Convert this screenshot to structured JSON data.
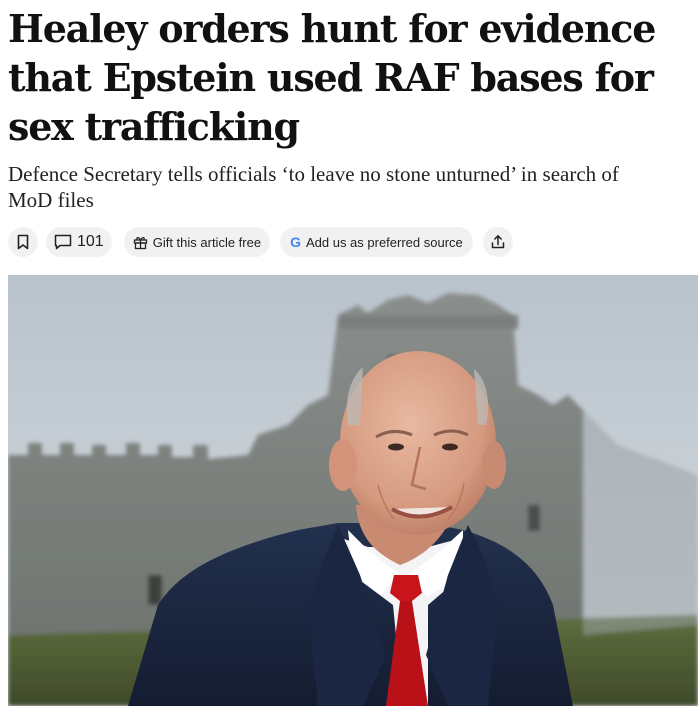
{
  "article": {
    "headline": "Healey orders hunt for evidence that Epstein used RAF bases for sex trafficking",
    "standfirst": "Defence Secretary tells officials ‘to leave no stone unturned’ in search of MoD files"
  },
  "actions": {
    "bookmark_icon": "bookmark-icon",
    "comment_icon": "comment-icon",
    "comment_count": "101",
    "gift_icon": "gift-icon",
    "gift_label": "Gift this article free",
    "google_icon": "google-g-icon",
    "google_letter": "G",
    "preferred_source_label": "Add us as preferred source",
    "share_icon": "share-icon"
  },
  "colors": {
    "pill_background": "#f1f1f1",
    "google_blue": "#4285F4",
    "tie_red": "#c8151c",
    "suit_navy": "#1c2a44"
  }
}
